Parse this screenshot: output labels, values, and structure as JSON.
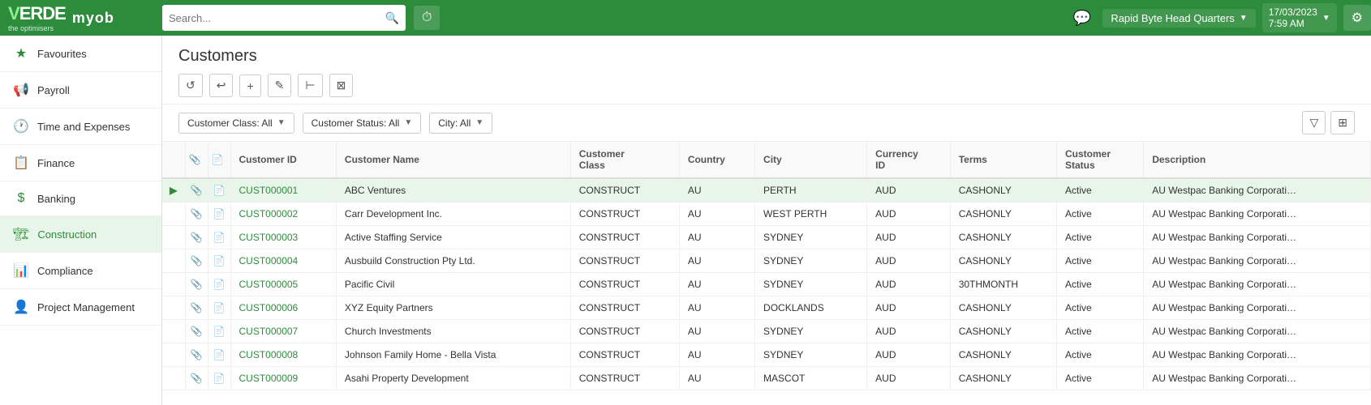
{
  "topNav": {
    "logoText": "VERDE",
    "logoSub": "the optimisers",
    "myobText": "myob",
    "searchPlaceholder": "Search...",
    "orgName": "Rapid Byte Head Quarters",
    "date": "17/03/2023",
    "time": "7:59 AM"
  },
  "sidebar": {
    "items": [
      {
        "id": "favourites",
        "label": "Favourites",
        "icon": "★"
      },
      {
        "id": "payroll",
        "label": "Payroll",
        "icon": "📢"
      },
      {
        "id": "time-and-expenses",
        "label": "Time and Expenses",
        "icon": "🕐"
      },
      {
        "id": "finance",
        "label": "Finance",
        "icon": "📋"
      },
      {
        "id": "banking",
        "label": "Banking",
        "icon": "$"
      },
      {
        "id": "construction",
        "label": "Construction",
        "icon": "🏗"
      },
      {
        "id": "compliance",
        "label": "Compliance",
        "icon": "📊"
      },
      {
        "id": "project-management",
        "label": "Project Management",
        "icon": "👤"
      }
    ]
  },
  "page": {
    "title": "Customers"
  },
  "toolbar": {
    "buttons": [
      {
        "id": "refresh",
        "label": "↺"
      },
      {
        "id": "undo",
        "label": "↩"
      },
      {
        "id": "add",
        "label": "+"
      },
      {
        "id": "edit",
        "label": "✎"
      },
      {
        "id": "merge",
        "label": "⊢"
      },
      {
        "id": "delete",
        "label": "⊠"
      }
    ]
  },
  "filters": {
    "customerClass": "Customer Class: All",
    "customerStatus": "Customer Status: All",
    "city": "City: All"
  },
  "table": {
    "columns": [
      {
        "id": "arrow",
        "label": ""
      },
      {
        "id": "attach",
        "label": ""
      },
      {
        "id": "doc",
        "label": ""
      },
      {
        "id": "customerId",
        "label": "Customer ID"
      },
      {
        "id": "customerName",
        "label": "Customer Name"
      },
      {
        "id": "customerClass",
        "label": "Customer Class"
      },
      {
        "id": "country",
        "label": "Country"
      },
      {
        "id": "city",
        "label": "City"
      },
      {
        "id": "currencyId",
        "label": "Currency ID"
      },
      {
        "id": "terms",
        "label": "Terms"
      },
      {
        "id": "customerStatus",
        "label": "Customer Status"
      },
      {
        "id": "description",
        "label": "Description"
      }
    ],
    "rows": [
      {
        "id": "CUST000001",
        "name": "ABC Ventures",
        "class": "CONSTRUCT",
        "country": "AU",
        "city": "PERTH",
        "currency": "AUD",
        "terms": "CASHONLY",
        "status": "Active",
        "description": "AU Westpac Banking Corporatio...",
        "selected": true,
        "hasAttach": true
      },
      {
        "id": "CUST000002",
        "name": "Carr Development Inc.",
        "class": "CONSTRUCT",
        "country": "AU",
        "city": "WEST PERTH",
        "currency": "AUD",
        "terms": "CASHONLY",
        "status": "Active",
        "description": "AU Westpac Banking Corporatio...",
        "selected": false,
        "hasAttach": true
      },
      {
        "id": "CUST000003",
        "name": "Active Staffing Service",
        "class": "CONSTRUCT",
        "country": "AU",
        "city": "SYDNEY",
        "currency": "AUD",
        "terms": "CASHONLY",
        "status": "Active",
        "description": "AU Westpac Banking Corporatio...",
        "selected": false,
        "hasAttach": false
      },
      {
        "id": "CUST000004",
        "name": "Ausbuild Construction Pty Ltd.",
        "class": "CONSTRUCT",
        "country": "AU",
        "city": "SYDNEY",
        "currency": "AUD",
        "terms": "CASHONLY",
        "status": "Active",
        "description": "AU Westpac Banking Corporatio...",
        "selected": false,
        "hasAttach": false
      },
      {
        "id": "CUST000005",
        "name": "Pacific Civil",
        "class": "CONSTRUCT",
        "country": "AU",
        "city": "SYDNEY",
        "currency": "AUD",
        "terms": "30THMONTH",
        "status": "Active",
        "description": "AU Westpac Banking Corporatio...",
        "selected": false,
        "hasAttach": false
      },
      {
        "id": "CUST000006",
        "name": "XYZ Equity Partners",
        "class": "CONSTRUCT",
        "country": "AU",
        "city": "DOCKLANDS",
        "currency": "AUD",
        "terms": "CASHONLY",
        "status": "Active",
        "description": "AU Westpac Banking Corporatio...",
        "selected": false,
        "hasAttach": false
      },
      {
        "id": "CUST000007",
        "name": "Church Investments",
        "class": "CONSTRUCT",
        "country": "AU",
        "city": "SYDNEY",
        "currency": "AUD",
        "terms": "CASHONLY",
        "status": "Active",
        "description": "AU Westpac Banking Corporatio...",
        "selected": false,
        "hasAttach": false
      },
      {
        "id": "CUST000008",
        "name": "Johnson Family Home - Bella Vista",
        "class": "CONSTRUCT",
        "country": "AU",
        "city": "SYDNEY",
        "currency": "AUD",
        "terms": "CASHONLY",
        "status": "Active",
        "description": "AU Westpac Banking Corporatio...",
        "selected": false,
        "hasAttach": false
      },
      {
        "id": "CUST000009",
        "name": "Asahi Property Development",
        "class": "CONSTRUCT",
        "country": "AU",
        "city": "MASCOT",
        "currency": "AUD",
        "terms": "CASHONLY",
        "status": "Active",
        "description": "AU Westpac Banking Corporatio...",
        "selected": false,
        "hasAttach": false
      }
    ]
  }
}
